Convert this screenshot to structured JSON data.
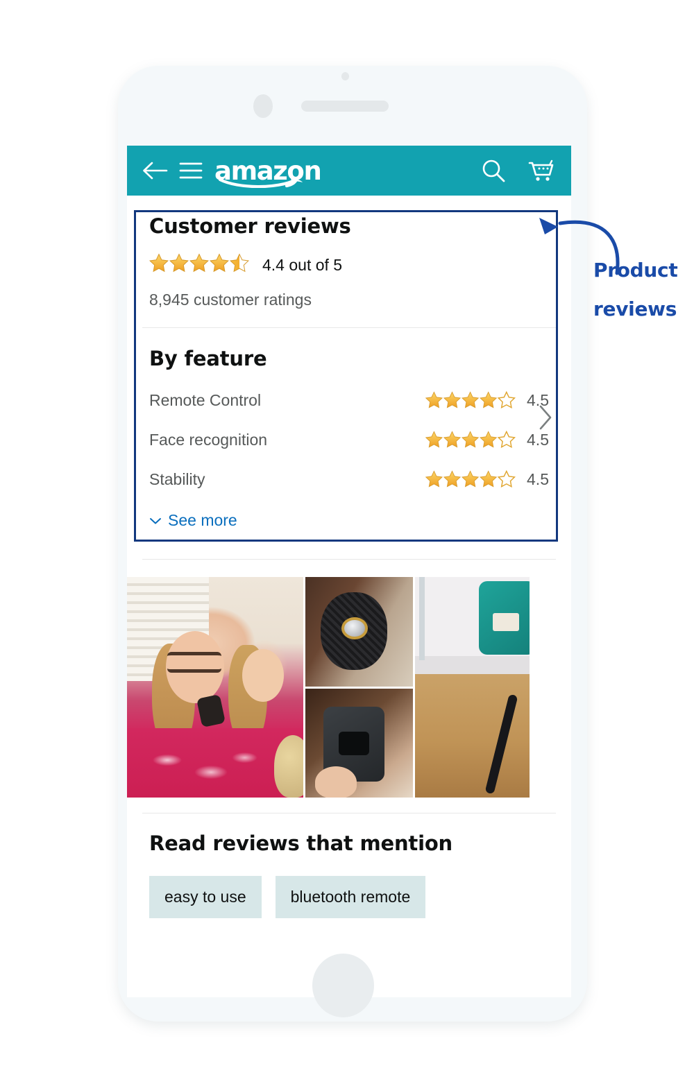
{
  "appbar": {
    "back_icon": "back-arrow-icon",
    "menu_icon": "hamburger-menu-icon",
    "logo_text": "amazon",
    "search_icon": "search-icon",
    "cart_icon": "shopping-cart-icon"
  },
  "reviews_card": {
    "title": "Customer reviews",
    "overall_rating_text": "4.4 out of 5",
    "overall_rating_value": 4.4,
    "overall_stars": 4.5,
    "ratings_count": "8,945 customer ratings",
    "chevron_icon": "chevron-right-icon",
    "by_feature_title": "By feature",
    "features": [
      {
        "name": "Remote Control",
        "score": "4.5",
        "stars": 4.5
      },
      {
        "name": "Face recognition",
        "score": "4.5",
        "stars": 4.5
      },
      {
        "name": "Stability",
        "score": "4.5",
        "stars": 4.5
      }
    ],
    "see_more_label": "See more",
    "see_more_icon": "chevron-down-icon"
  },
  "photos": {
    "items": [
      {
        "alt": "customer selfie holding remote"
      },
      {
        "alt": "close-up of black textured knob with gem"
      },
      {
        "alt": "black rectangular remote in hand"
      },
      {
        "alt": "room floor with teal device"
      }
    ]
  },
  "mentions": {
    "title": "Read reviews that mention",
    "chips": [
      "easy to use",
      "bluetooth remote"
    ]
  },
  "annotation": {
    "label_line1": "Product",
    "label_line2": "reviews",
    "arrow_icon": "curved-arrow-icon",
    "box_color": "#12387e",
    "text_color": "#1a4ba8"
  },
  "colors": {
    "appbar_teal": "#12a2b0",
    "star_amber": "#f3a724",
    "link_blue": "#0a6ebd",
    "chip_bg": "#d7e7e8",
    "text_primary": "#0f1111",
    "text_secondary": "#565959"
  }
}
